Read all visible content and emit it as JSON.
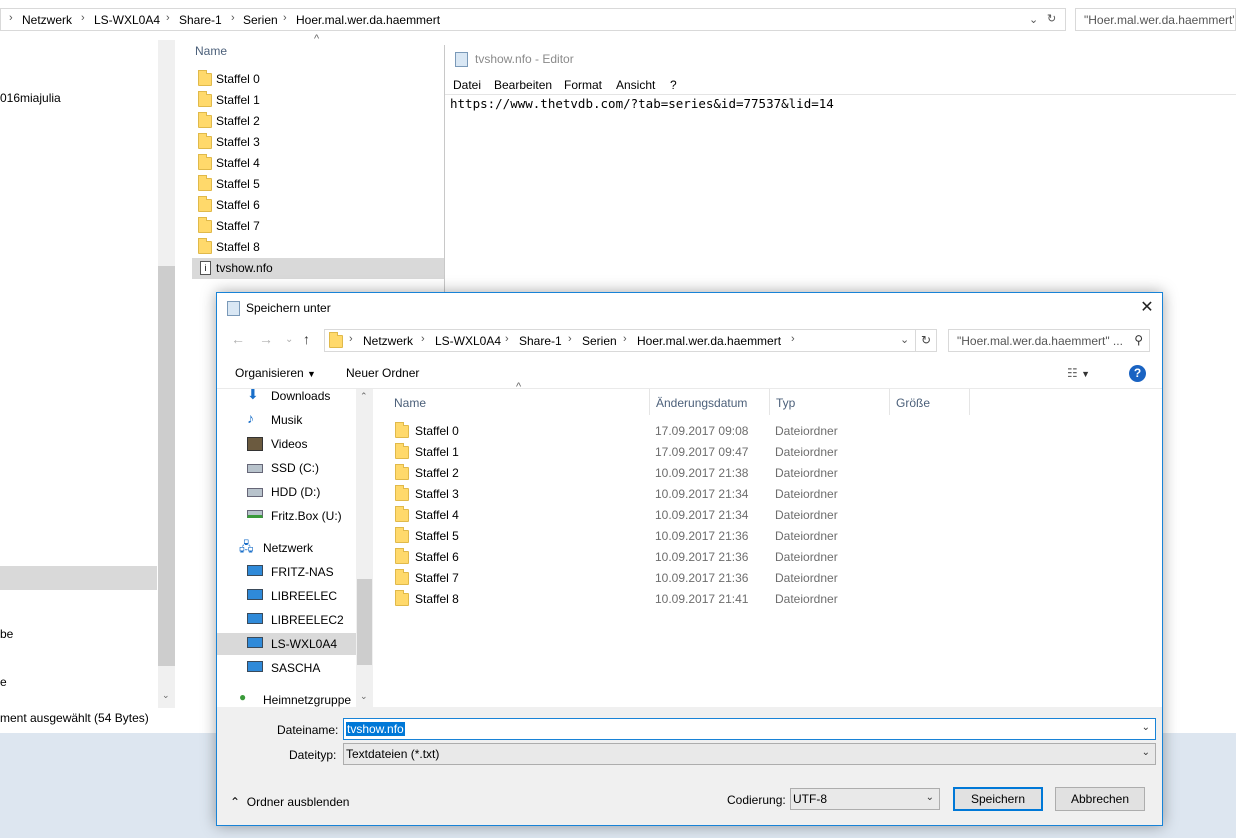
{
  "explorer": {
    "breadcrumb": [
      "Netzwerk",
      "LS-WXL0A4",
      "Share-1",
      "Serien",
      "Hoer.mal.wer.da.haemmert"
    ],
    "search_placeholder": "\"Hoer.mal.wer.da.haemmert\"",
    "nav_fragments": [
      "016miajulia",
      "be",
      "e"
    ],
    "column_name": "Name",
    "files": [
      {
        "name": "Staffel 0",
        "type": "folder"
      },
      {
        "name": "Staffel 1",
        "type": "folder"
      },
      {
        "name": "Staffel 2",
        "type": "folder"
      },
      {
        "name": "Staffel 3",
        "type": "folder"
      },
      {
        "name": "Staffel 4",
        "type": "folder"
      },
      {
        "name": "Staffel 5",
        "type": "folder"
      },
      {
        "name": "Staffel 6",
        "type": "folder"
      },
      {
        "name": "Staffel 7",
        "type": "folder"
      },
      {
        "name": "Staffel 8",
        "type": "folder"
      },
      {
        "name": "tvshow.nfo",
        "type": "file",
        "selected": true
      }
    ],
    "status": "ment ausgewählt (54 Bytes)"
  },
  "editor": {
    "title": "tvshow.nfo - Editor",
    "menu": [
      "Datei",
      "Bearbeiten",
      "Format",
      "Ansicht",
      "?"
    ],
    "content": "https://www.thetvdb.com/?tab=series&id=77537&lid=14"
  },
  "dialog": {
    "title": "Speichern unter",
    "close": "✕",
    "breadcrumb": [
      "Netzwerk",
      "LS-WXL0A4",
      "Share-1",
      "Serien",
      "Hoer.mal.wer.da.haemmert"
    ],
    "search_placeholder": "\"Hoer.mal.wer.da.haemmert\" ...",
    "toolbar": {
      "organize": "Organisieren",
      "new_folder": "Neuer Ordner",
      "help": "?"
    },
    "nav": [
      {
        "label": "Downloads",
        "icon": "download-icon"
      },
      {
        "label": "Musik",
        "icon": "music-icon"
      },
      {
        "label": "Videos",
        "icon": "video-icon"
      },
      {
        "label": "SSD (C:)",
        "icon": "drive-icon"
      },
      {
        "label": "HDD (D:)",
        "icon": "drive-icon"
      },
      {
        "label": "Fritz.Box (U:)",
        "icon": "network-drive-icon"
      },
      {
        "label": "Netzwerk",
        "icon": "network-icon"
      },
      {
        "label": "FRITZ-NAS",
        "icon": "computer-icon"
      },
      {
        "label": "LIBREELEC",
        "icon": "computer-icon"
      },
      {
        "label": "LIBREELEC2",
        "icon": "computer-icon"
      },
      {
        "label": "LS-WXL0A4",
        "icon": "computer-icon",
        "selected": true
      },
      {
        "label": "SASCHA",
        "icon": "computer-icon"
      },
      {
        "label": "Heimnetzgruppe",
        "icon": "homegroup-icon"
      }
    ],
    "columns": [
      "Name",
      "Änderungsdatum",
      "Typ",
      "Größe"
    ],
    "rows": [
      {
        "name": "Staffel 0",
        "date": "17.09.2017 09:08",
        "type": "Dateiordner"
      },
      {
        "name": "Staffel 1",
        "date": "17.09.2017 09:47",
        "type": "Dateiordner"
      },
      {
        "name": "Staffel 2",
        "date": "10.09.2017 21:38",
        "type": "Dateiordner"
      },
      {
        "name": "Staffel 3",
        "date": "10.09.2017 21:34",
        "type": "Dateiordner"
      },
      {
        "name": "Staffel 4",
        "date": "10.09.2017 21:34",
        "type": "Dateiordner"
      },
      {
        "name": "Staffel 5",
        "date": "10.09.2017 21:36",
        "type": "Dateiordner"
      },
      {
        "name": "Staffel 6",
        "date": "10.09.2017 21:36",
        "type": "Dateiordner"
      },
      {
        "name": "Staffel 7",
        "date": "10.09.2017 21:36",
        "type": "Dateiordner"
      },
      {
        "name": "Staffel 8",
        "date": "10.09.2017 21:41",
        "type": "Dateiordner"
      }
    ],
    "filename_label": "Dateiname:",
    "filename_value": "tvshow.nfo",
    "filetype_label": "Dateityp:",
    "filetype_value": "Textdateien (*.txt)",
    "hide_folders": "Ordner ausblenden",
    "encoding_label": "Codierung:",
    "encoding_value": "UTF-8",
    "save_button": "Speichern",
    "cancel_button": "Abbrechen"
  },
  "colors": {
    "accent": "#0078d7",
    "folder": "#ffd96b",
    "selection": "#d9d9d9"
  }
}
